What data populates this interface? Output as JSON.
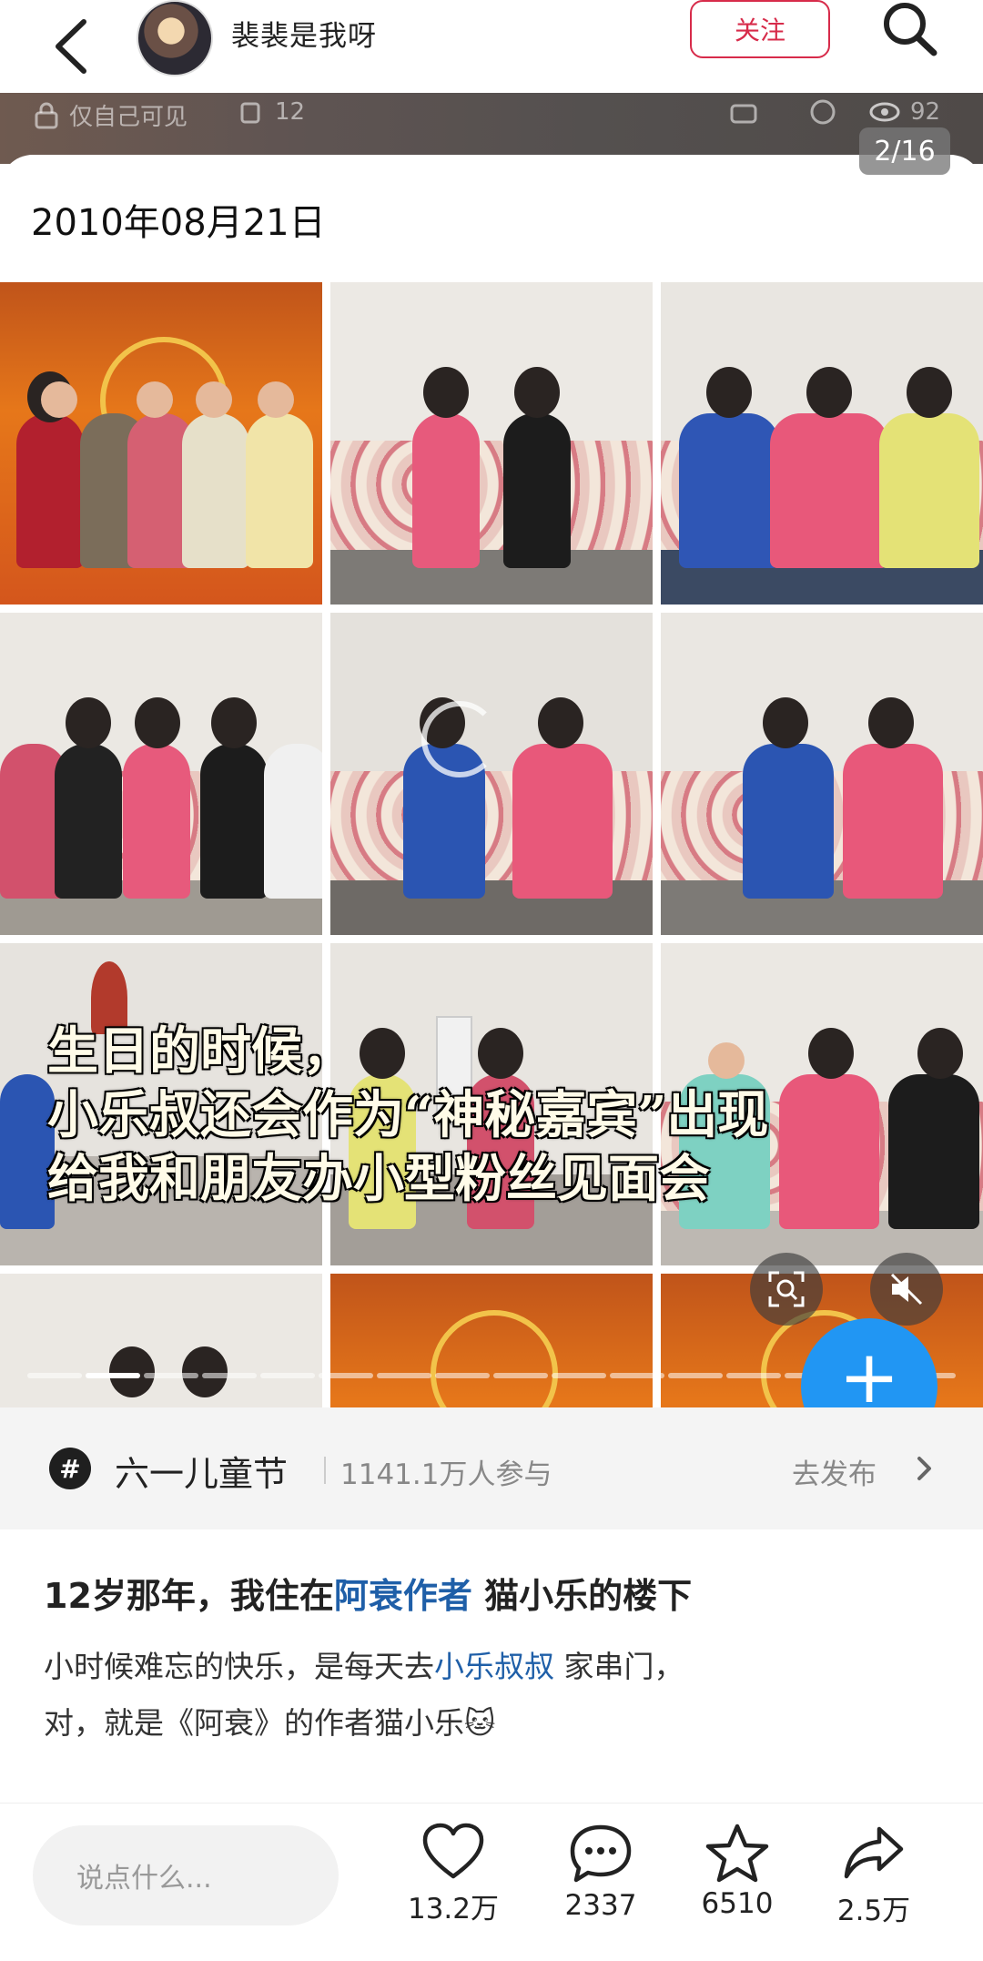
{
  "header": {
    "username": "裴裴是我呀",
    "follow_label": "关注"
  },
  "strip": {
    "privacy": "仅自己可见",
    "copies": "12",
    "views": "92"
  },
  "gallery": {
    "counter": "2/16",
    "date": "2010年08月21日",
    "overlay_lines": [
      "生日的时候，",
      "小乐叔还会作为“神秘嘉宾”出现",
      "给我和朋友办小型粉丝见面会"
    ]
  },
  "topic": {
    "name": "六一儿童节",
    "participants": "1141.1万人参与",
    "action": "去发布"
  },
  "post": {
    "title_pre": "12岁那年，我住在",
    "title_tag": "阿衰作者",
    "title_post": "猫小乐的楼下",
    "line1_pre": "小时候难忘的快乐，是每天去",
    "line1_tag": "小乐叔叔",
    "line1_post": "家串门，",
    "line2": "对，就是《阿衰》的作者猫小乐🐱"
  },
  "bottom": {
    "comment_placeholder": "说点什么...",
    "likes": "13.2万",
    "comments": "2337",
    "favorites": "6510",
    "shares": "2.5万"
  },
  "colors": {
    "accent": "#d72b4a",
    "link": "#1f5fa8",
    "fab": "#2196f3"
  }
}
